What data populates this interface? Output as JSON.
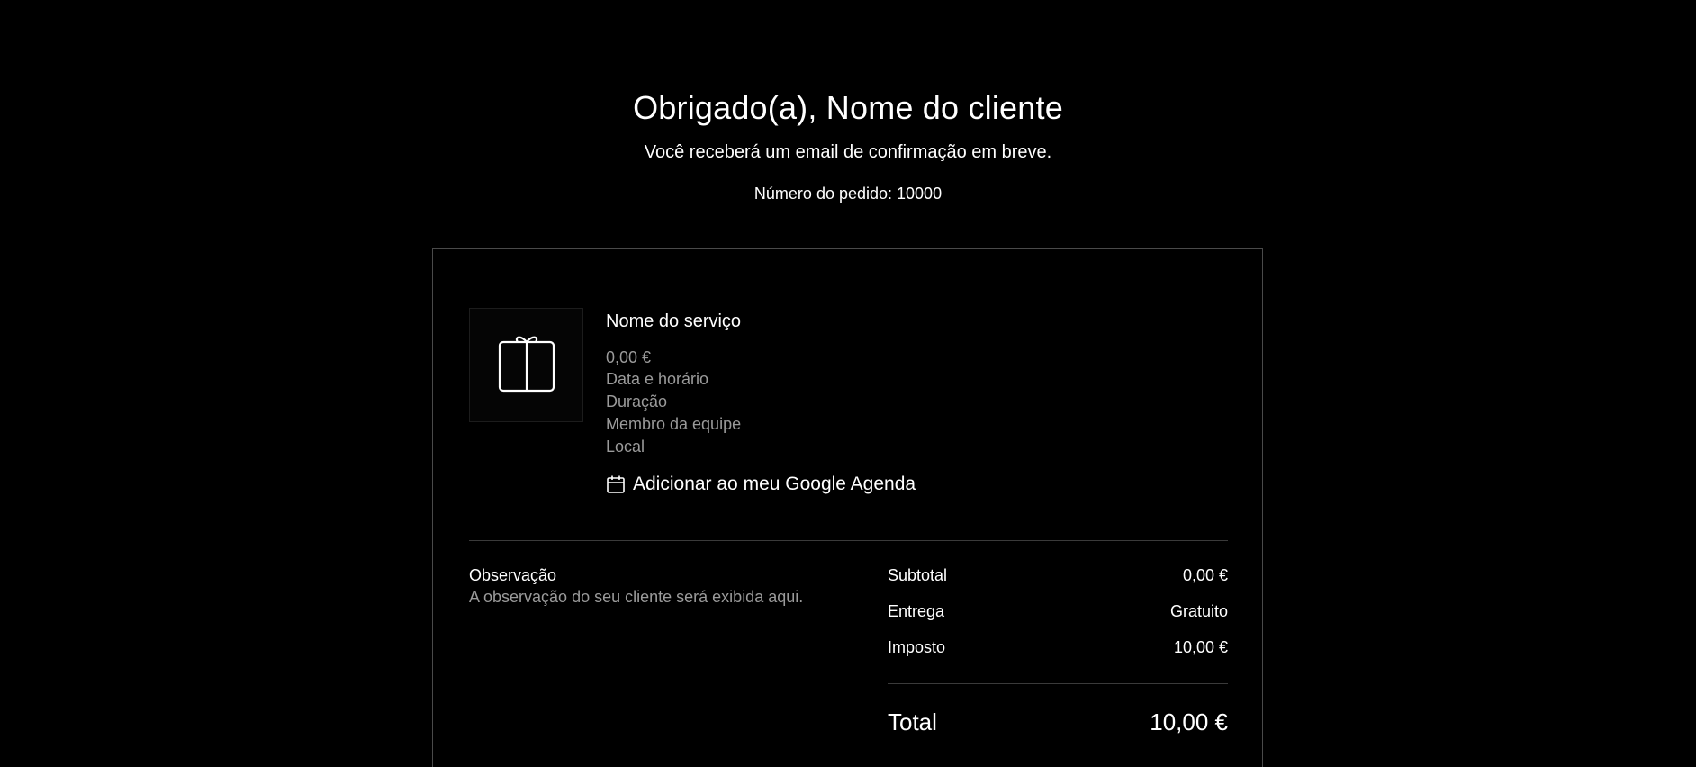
{
  "header": {
    "title": "Obrigado(a), Nome do cliente",
    "subtitle": "Você receberá um email de confirmação em breve.",
    "order_number": "Número do pedido: 10000"
  },
  "item": {
    "icon": "gift-icon",
    "name": "Nome do serviço",
    "price": "0,00 €",
    "date_time": "Data e horário",
    "duration": "Duração",
    "staff": "Membro da equipe",
    "location": "Local",
    "calendar_icon": "calendar-icon",
    "calendar_link": "Adicionar ao meu Google Agenda"
  },
  "note": {
    "label": "Observação",
    "text": "A observação do seu cliente será exibida aqui."
  },
  "summary": {
    "subtotal_label": "Subtotal",
    "subtotal_value": "0,00 €",
    "shipping_label": "Entrega",
    "shipping_value": "Gratuito",
    "tax_label": "Imposto",
    "tax_value": "10,00 €",
    "total_label": "Total",
    "total_value": "10,00 €"
  },
  "colors": {
    "background": "#000000",
    "text": "#ffffff",
    "muted_text": "#9a9a9a",
    "border": "#4a4a4a"
  }
}
